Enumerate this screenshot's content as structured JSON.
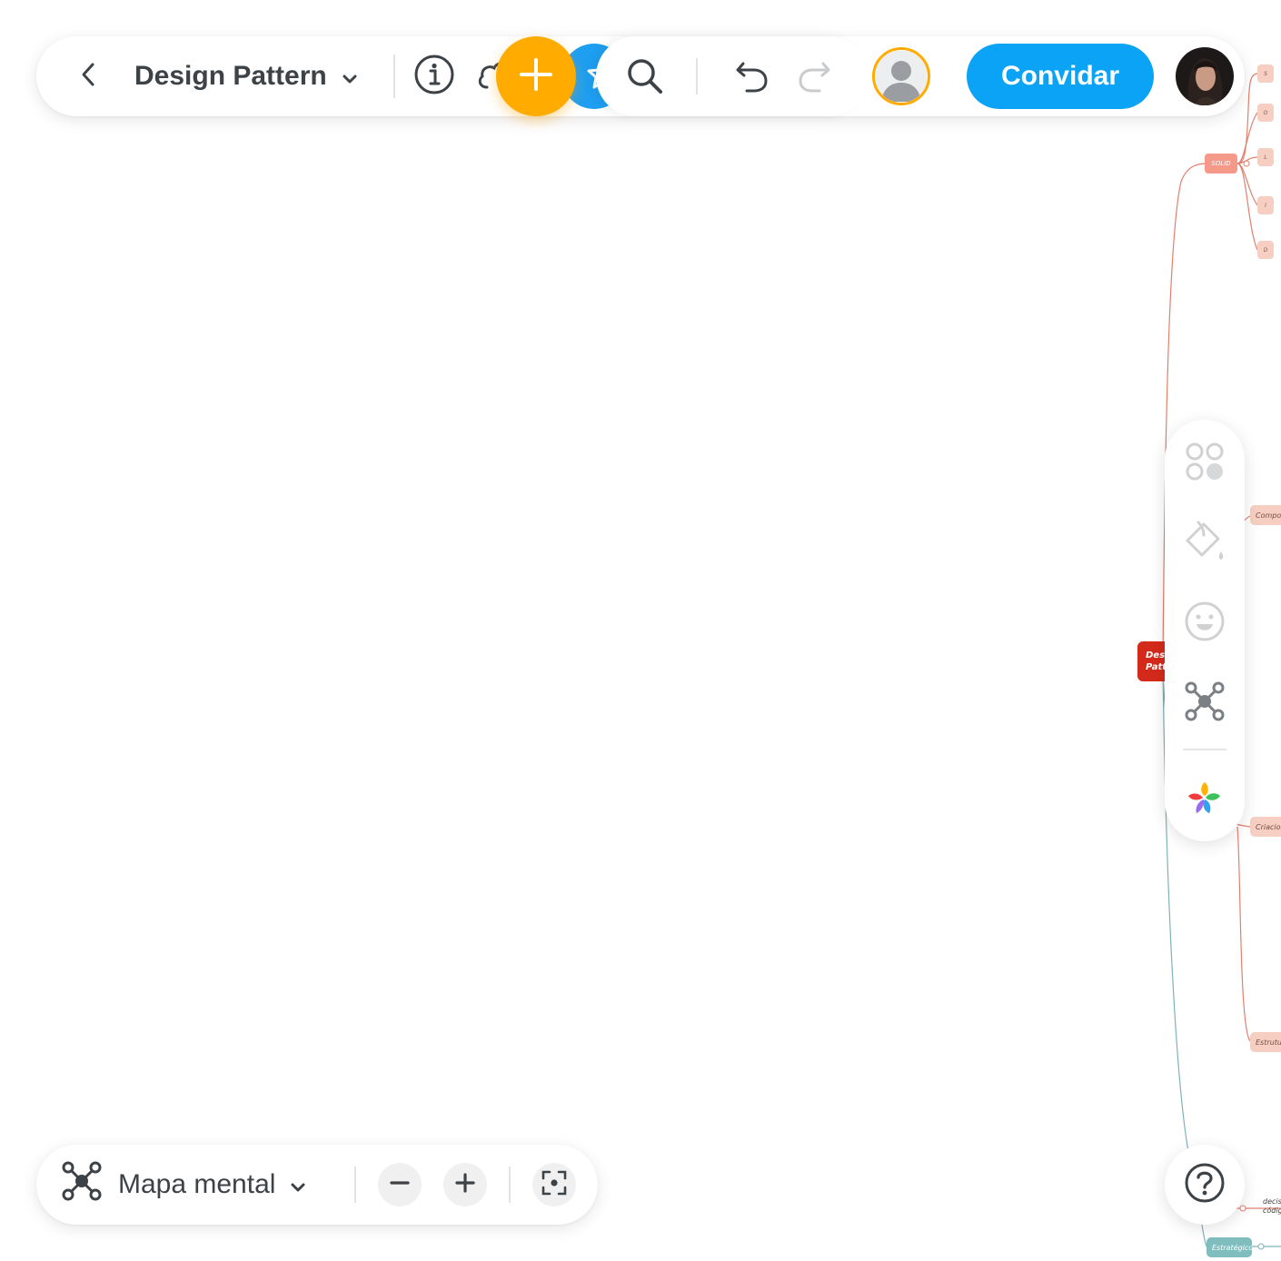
{
  "toolbar": {
    "doc_title": "Design Pattern",
    "invite_label": "Convidar"
  },
  "bottom_bar": {
    "layout_label": "Mapa mental"
  },
  "mindmap": {
    "root": "Design Pattern",
    "root_visible_lines": [
      "Desi",
      "Patt"
    ],
    "solid": "SOLID",
    "solid_letters": [
      "S",
      "O",
      "L",
      "I",
      "D"
    ],
    "branches": [
      "Compor",
      "Criacion",
      "Estrutur"
    ],
    "strategic": "Estratégico",
    "strategic_notes": [
      "decisõ",
      "códig"
    ]
  },
  "colors": {
    "brand_blue": "#0aa3f5",
    "add_orange": "#ffab00",
    "root_red": "#d42a1b",
    "branch_pink": "#f6cfc2",
    "solid_salmon": "#f59a8a",
    "strategic_teal": "#7fbdbf"
  },
  "icons": {
    "back": "chevron-left-icon",
    "title_dropdown": "chevron-down-icon",
    "info": "info-icon",
    "cloud": "cloud-icon",
    "add": "plus-icon",
    "star": "star-icon",
    "search": "search-icon",
    "undo": "undo-icon",
    "redo": "redo-icon",
    "structure": "mindmap-structure-icon",
    "zoom_out": "minus-icon",
    "zoom_in": "plus-icon",
    "fit": "focus-frame-icon",
    "templates": "grid-circles-icon",
    "style": "paint-bucket-icon",
    "stickers": "emoji-icon",
    "map_structure": "mindmap-structure-icon",
    "colors": "color-flower-icon",
    "help": "help-icon"
  }
}
